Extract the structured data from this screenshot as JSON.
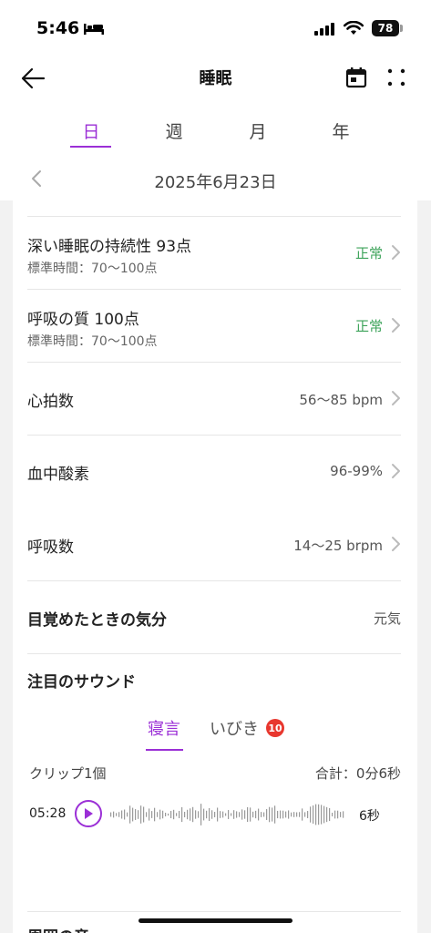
{
  "status_bar": {
    "time": "5:46",
    "battery": "78"
  },
  "header": {
    "title": "睡眠"
  },
  "period_tabs": [
    {
      "label": "日",
      "active": true
    },
    {
      "label": "週",
      "active": false
    },
    {
      "label": "月",
      "active": false
    },
    {
      "label": "年",
      "active": false
    }
  ],
  "date": {
    "label": "2025年6月23日"
  },
  "rows": [
    {
      "title": "深い睡眠の持続性 93点",
      "sub": "標準時間：70～100点",
      "status": "正常"
    },
    {
      "title": "呼吸の質 100点",
      "sub": "標準時間：70～100点",
      "status": "正常"
    },
    {
      "title": "心拍数",
      "value": "56～85 bpm"
    },
    {
      "title": "血中酸素",
      "value": "96-99%"
    },
    {
      "title": "呼吸数",
      "value": "14～25 brpm"
    },
    {
      "title": "目覚めたときの気分",
      "value": "元気"
    }
  ],
  "sound": {
    "section_title": "注目のサウンド",
    "tabs": [
      {
        "label": "寝言",
        "active": true
      },
      {
        "label": "いびき",
        "active": false,
        "badge": "10"
      }
    ],
    "clip_count": "クリップ1個",
    "total": "合計：0分6秒",
    "clip": {
      "time": "05:28",
      "duration": "6秒"
    }
  },
  "next_section": {
    "title": "周囲の音"
  },
  "colors": {
    "accent": "#9b2fd6",
    "normal": "#3da35a",
    "badge": "#e8372e"
  }
}
